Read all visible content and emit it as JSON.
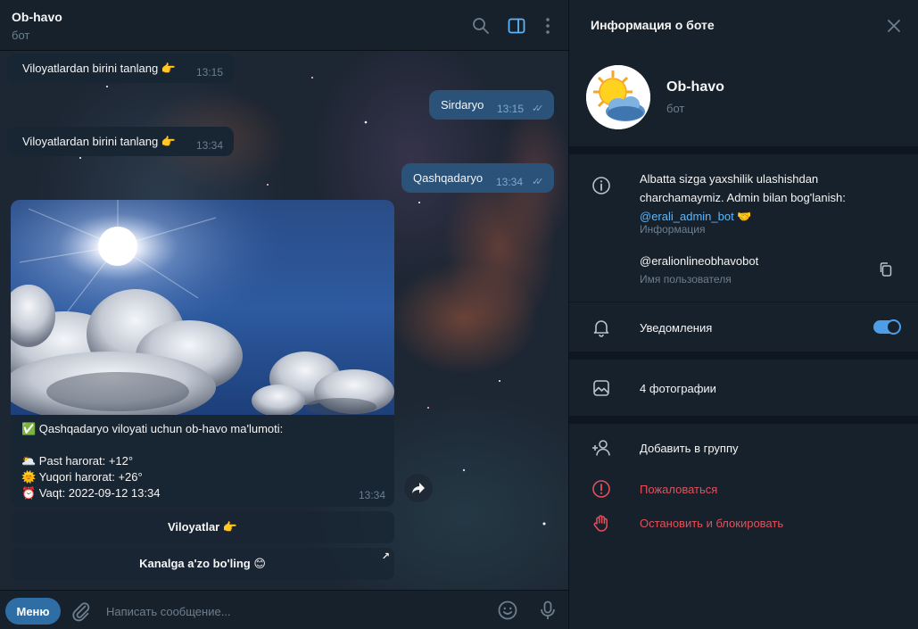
{
  "chat": {
    "title": "Ob-havo",
    "subtitle": "бот",
    "messages": [
      {
        "text": "Viloyatlardan birini tanlang 👉",
        "time": "13:15"
      },
      {
        "text": "Sirdaryo",
        "time": "13:15"
      },
      {
        "text": "Viloyatlardan birini tanlang 👉",
        "time": "13:34"
      },
      {
        "text": "Qashqadaryo",
        "time": "13:34"
      }
    ],
    "photo_message": {
      "lines": [
        "✅ Qashqadaryo viloyati uchun ob-havo ma'lumoti:",
        "",
        "🌥️ Past harorat:  +12°",
        "🌞 Yuqori harorat:  +26°",
        "⏰ Vaqt: 2022-09-12 13:34"
      ],
      "time": "13:34"
    },
    "keyboard": [
      {
        "label": "Viloyatlar 👉"
      },
      {
        "label": "Kanalga a'zo bo'ling 😊",
        "arrow": "↗"
      }
    ],
    "composer": {
      "menu_label": "Меню",
      "placeholder": "Написать сообщение..."
    }
  },
  "panel": {
    "title": "Информация о боте",
    "name": "Ob-havo",
    "subtitle": "бот",
    "about_text": "Albatta sizga yaxshilik ulashishdan charchamaymiz.  Admin bilan bog'lanish:",
    "about_link": "@erali_admin_bot",
    "about_emoji": "🤝",
    "about_label": "Информация",
    "username": "@eralionlineobhavobot",
    "username_label": "Имя пользователя",
    "notifications_label": "Уведомления",
    "notifications_on": true,
    "photos_label": "4 фотографии",
    "add_to_group": "Добавить в группу",
    "report": "Пожаловаться",
    "stop_block": "Остановить и блокировать"
  },
  "colors": {
    "accent": "#5eb5f7",
    "danger": "#e3505a",
    "outgoing_bubble": "#2b5278",
    "incoming_bubble": "#182533"
  }
}
